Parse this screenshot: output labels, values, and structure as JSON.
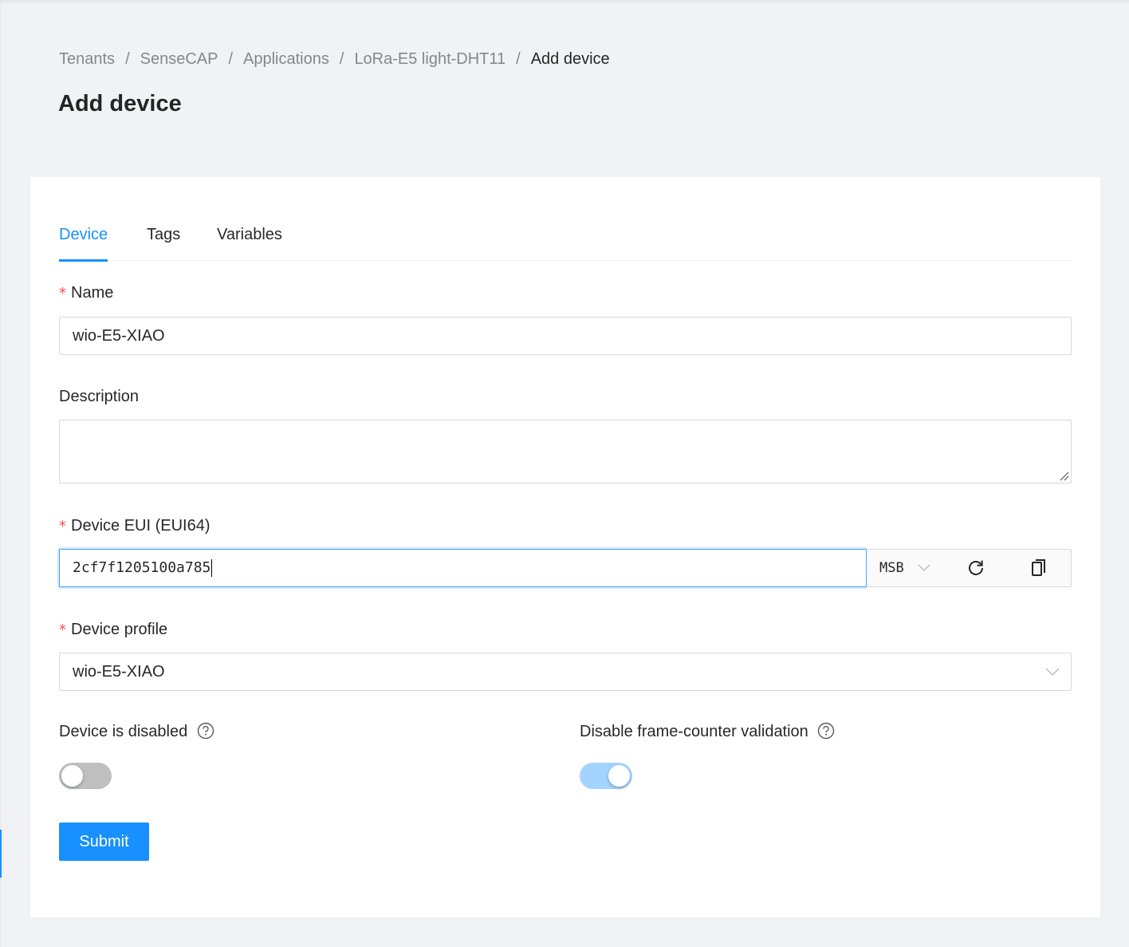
{
  "breadcrumb": {
    "items": [
      "Tenants",
      "SenseCAP",
      "Applications",
      "LoRa-E5 light-DHT11",
      "Add device"
    ],
    "separator": "/"
  },
  "page": {
    "title": "Add device"
  },
  "tabs": [
    {
      "label": "Device",
      "active": true
    },
    {
      "label": "Tags",
      "active": false
    },
    {
      "label": "Variables",
      "active": false
    }
  ],
  "form": {
    "required_mark": "*",
    "name": {
      "label": "Name",
      "value": "wio-E5-XIAO"
    },
    "description": {
      "label": "Description",
      "value": ""
    },
    "dev_eui": {
      "label": "Device EUI (EUI64)",
      "value": "2cf7f1205100a785",
      "byte_order": "MSB"
    },
    "device_profile": {
      "label": "Device profile",
      "value": "wio-E5-XIAO"
    },
    "device_disabled": {
      "label": "Device is disabled",
      "checked": false
    },
    "skip_fcnt_check": {
      "label": "Disable frame-counter validation",
      "checked": true
    },
    "submit_label": "Submit"
  },
  "colors": {
    "primary": "#1890ff",
    "required": "#ff4d4f",
    "page_bg": "#f0f2f5",
    "switch_on": "#a3d3ff",
    "switch_off": "#bfbfbf"
  },
  "icons": {
    "byte_order_dropdown": "chevron-down-icon",
    "generate": "refresh-icon",
    "copy": "copy-icon",
    "select": "chevron-down-icon",
    "help": "question-circle-icon"
  }
}
